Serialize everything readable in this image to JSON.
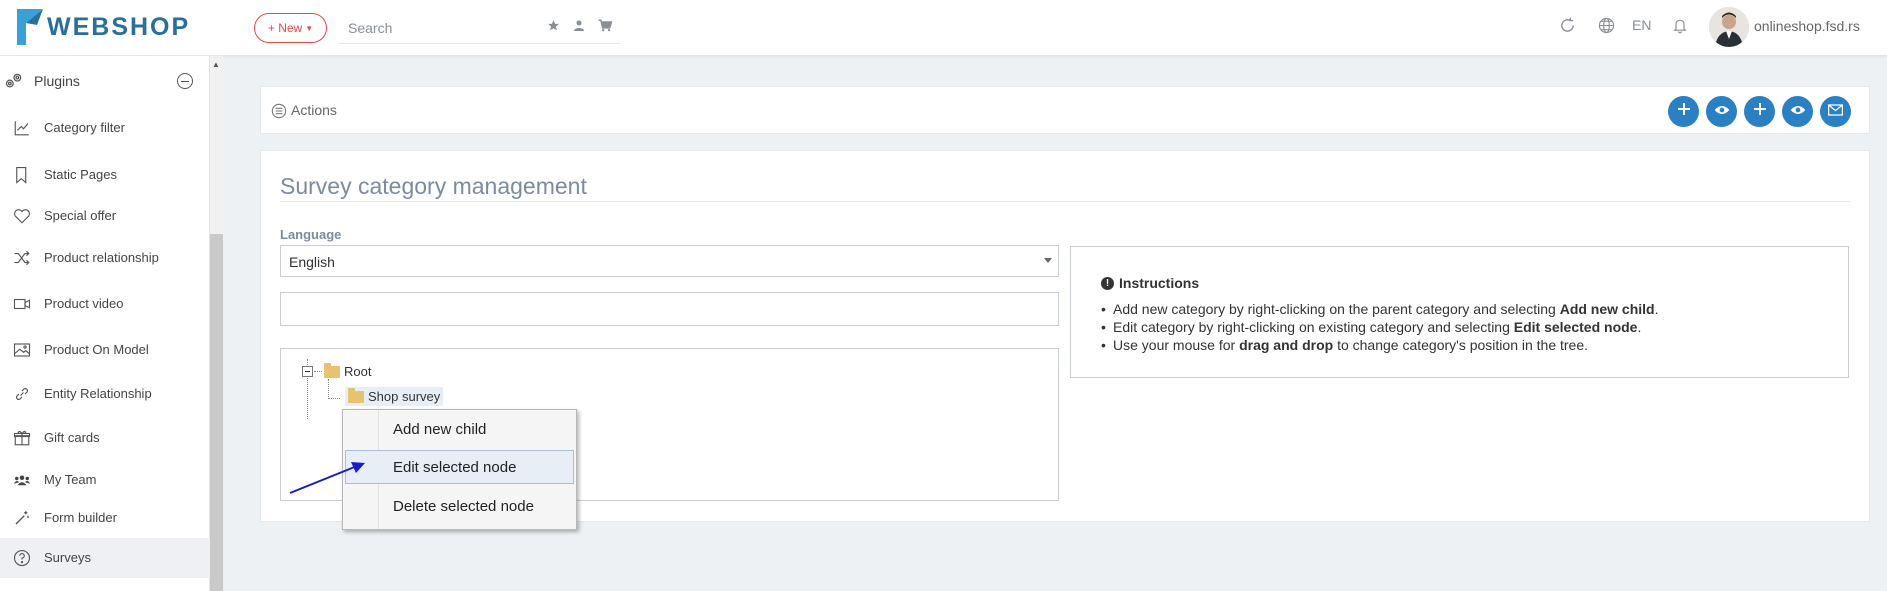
{
  "app": {
    "logo_text": "WEBSHOP",
    "new_button_label": "+ New",
    "search_placeholder": "Search",
    "language_code": "EN",
    "user_name": "onlineshop.fsd.rs"
  },
  "sidebar": {
    "section_title": "Plugins",
    "items": [
      {
        "label": "Category filter",
        "icon": "chart-icon"
      },
      {
        "label": "Static Pages",
        "icon": "bookmark-icon"
      },
      {
        "label": "Special offer",
        "icon": "heart-icon"
      },
      {
        "label": "Product relationship",
        "icon": "shuffle-icon"
      },
      {
        "label": "Product video",
        "icon": "video-icon"
      },
      {
        "label": "Product On Model",
        "icon": "image-icon"
      },
      {
        "label": "Entity Relationship",
        "icon": "link-icon"
      },
      {
        "label": "Gift cards",
        "icon": "gift-icon"
      },
      {
        "label": "My Team",
        "icon": "users-icon"
      },
      {
        "label": "Form builder",
        "icon": "wand-icon"
      },
      {
        "label": "Surveys",
        "icon": "question-icon",
        "active": true
      }
    ]
  },
  "actions": {
    "label": "Actions",
    "buttons": [
      "add-icon",
      "eye-icon",
      "add-icon",
      "eye-icon",
      "mail-icon"
    ],
    "button_color": "#2a80c3"
  },
  "main": {
    "title": "Survey category management",
    "language_label": "Language",
    "language_value": "English",
    "tree_search_value": "",
    "tree": {
      "root_label": "Root",
      "child_label": "Shop survey"
    },
    "instructions": {
      "title": "Instructions",
      "items": [
        {
          "pre": "Add new category by right-clicking on the parent category and selecting ",
          "bold": "Add new child",
          "post": "."
        },
        {
          "pre": "Edit category by right-clicking on existing category and selecting ",
          "bold": "Edit selected node",
          "post": "."
        },
        {
          "pre": "Use your mouse for ",
          "bold": "drag and drop",
          "post": " to change category's position in the tree."
        }
      ]
    }
  },
  "context_menu": {
    "items": [
      "Add new child",
      "Edit selected node",
      "Delete selected node"
    ],
    "hovered_index": 1
  },
  "colors": {
    "accent": "#2a80c3",
    "new_button": "#e04b4b",
    "annotation_arrow": "#1a1acc"
  }
}
